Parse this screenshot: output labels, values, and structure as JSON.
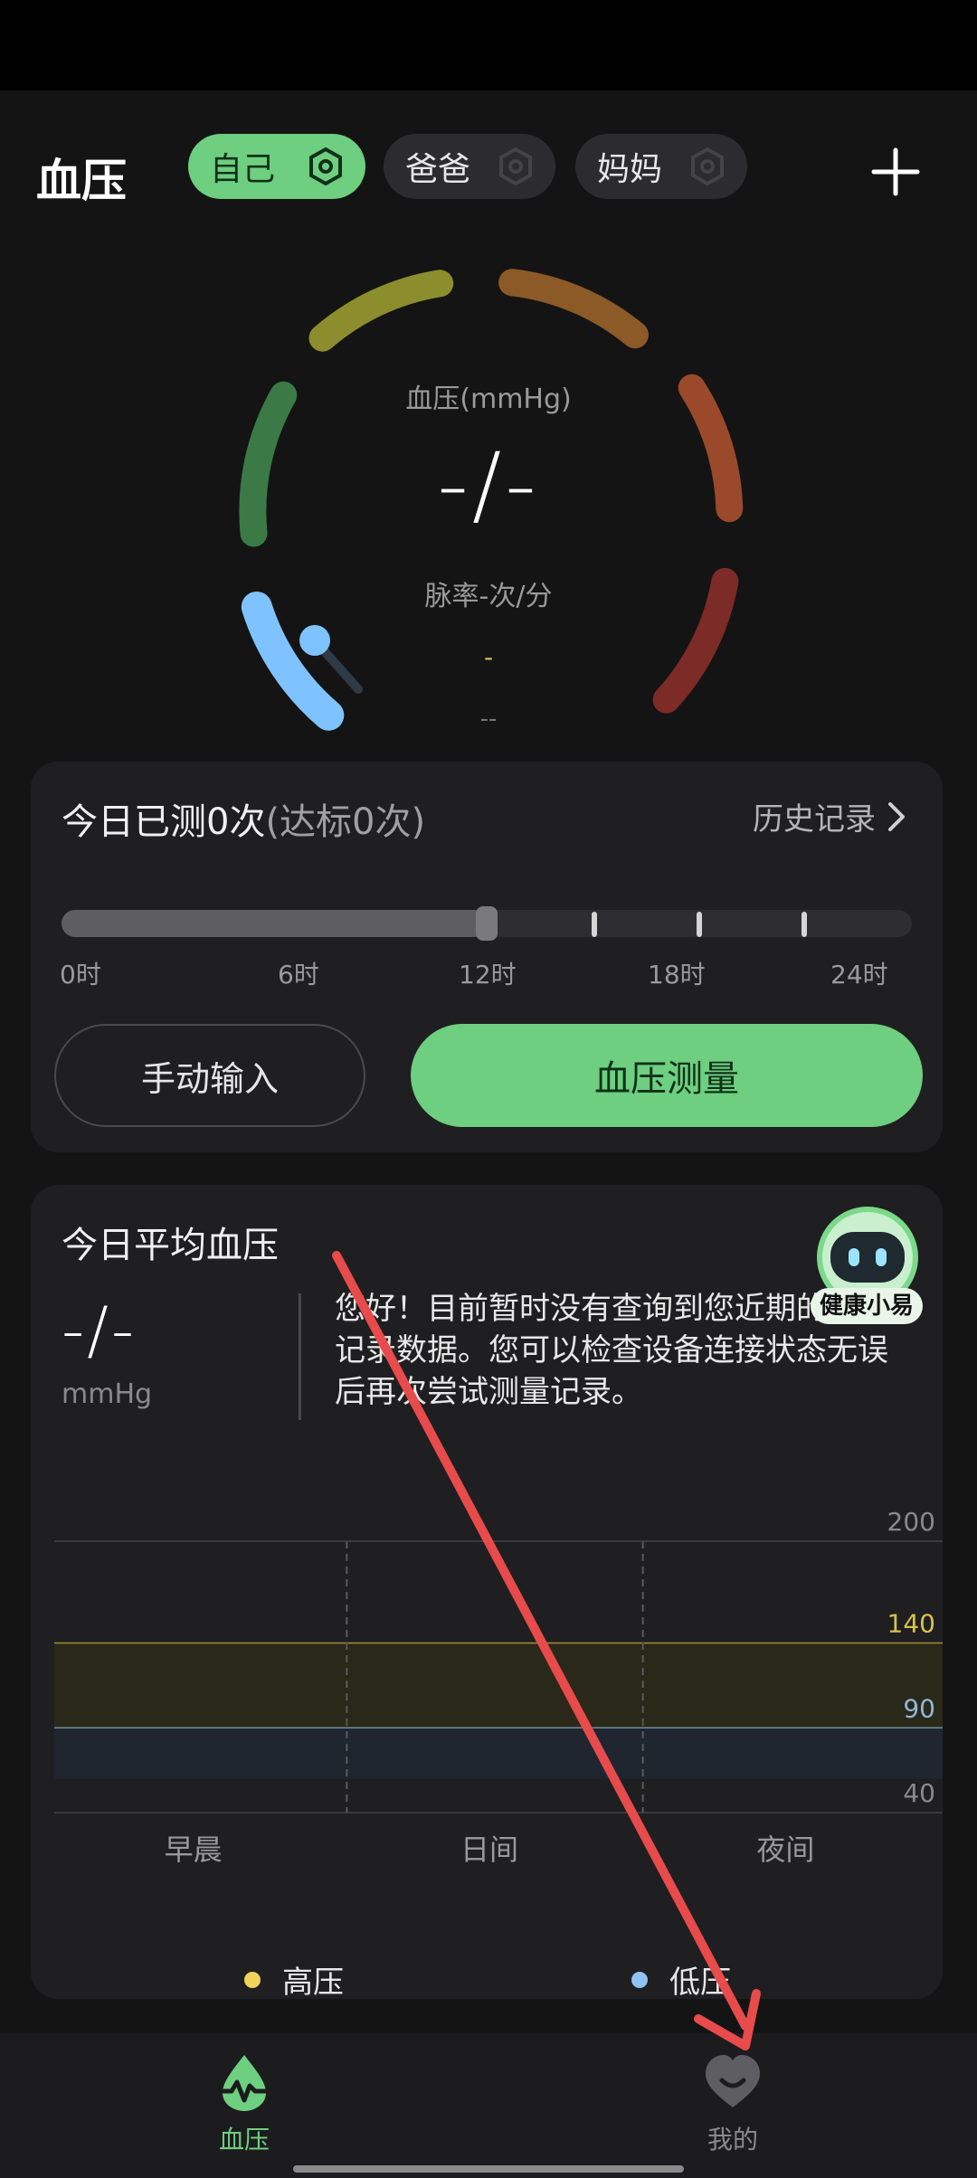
{
  "header": {
    "title": "血压",
    "profiles": [
      {
        "label": "自己",
        "active": true
      },
      {
        "label": "爸爸",
        "active": false
      },
      {
        "label": "妈妈",
        "active": false
      }
    ],
    "add_icon": "plus-icon",
    "settings_icon": "gear-icon"
  },
  "gauge": {
    "label": "血压(mmHg)",
    "value": "-/-",
    "pulse_label": "脉率",
    "pulse_value": "-",
    "pulse_unit": "次/分",
    "indicator_1": "-",
    "indicator_2": "--"
  },
  "today": {
    "title": "今日已测0次",
    "subtitle": "(达标0次)",
    "history_label": "历史记录",
    "hours": [
      "0时",
      "6时",
      "12时",
      "18时",
      "24时"
    ],
    "current_time_fraction": 0.5,
    "manual_input_label": "手动输入",
    "measure_label": "血压测量"
  },
  "average": {
    "title": "今日平均血压",
    "value": "-/-",
    "unit": "mmHg",
    "assistant_name": "健康小易",
    "message": "您好！目前暂时没有查询到您近期的血压记录数据。您可以检查设备连接状态无误后再次尝试测量记录。"
  },
  "chart_data": {
    "type": "line",
    "categories": [
      "早晨",
      "日间",
      "夜间"
    ],
    "y_ticks": [
      200,
      140,
      90,
      40
    ],
    "ylim": [
      40,
      200
    ],
    "series": [
      {
        "name": "高压",
        "values": []
      },
      {
        "name": "低压",
        "values": []
      }
    ],
    "bands": [
      {
        "from": 90,
        "to": 140,
        "color": "#2a2818"
      },
      {
        "from": 60,
        "to": 90,
        "color": "#1f2630"
      }
    ],
    "threshold_colors": {
      "140": "#d8c24a",
      "90": "#8fb8d8"
    },
    "legend_colors": {
      "高压": "#f0d35a",
      "低压": "#8ec3f0"
    }
  },
  "nav": {
    "items": [
      {
        "label": "血压",
        "icon": "heartbeat-drop-icon",
        "active": true
      },
      {
        "label": "我的",
        "icon": "heart-smile-icon",
        "active": false
      }
    ]
  },
  "colors": {
    "accent": "#6dcf7f",
    "background": "#141414",
    "card": "#1f1f21",
    "annotation": "#e84b4b"
  }
}
